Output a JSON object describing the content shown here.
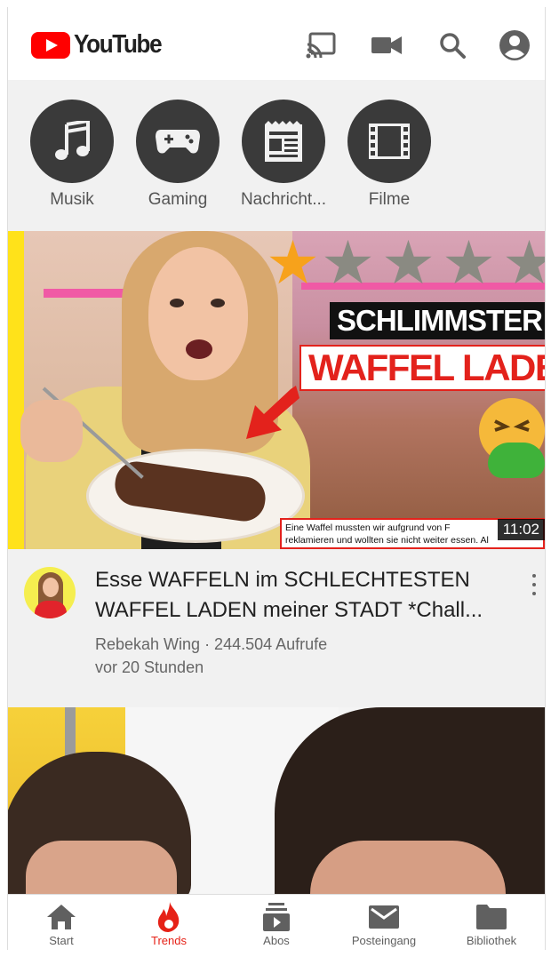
{
  "header": {
    "logo_text": "YouTube",
    "icons": [
      "cast-icon",
      "camera-icon",
      "search-icon",
      "account-icon"
    ]
  },
  "categories": [
    {
      "label": "Musik",
      "icon": "music-icon"
    },
    {
      "label": "Gaming",
      "icon": "gamepad-icon"
    },
    {
      "label": "Nachricht...",
      "icon": "news-icon"
    },
    {
      "label": "Filme",
      "icon": "film-icon"
    }
  ],
  "video1": {
    "thumbnail_text_top": "SCHLIMMSTER",
    "thumbnail_text_main": "WAFFEL LADEN",
    "thumbnail_caption_line1": "Eine Waffel mussten wir aufgrund von F",
    "thumbnail_caption_line2": "reklamieren und wollten sie nicht weiter essen. Al",
    "duration": "11:02",
    "title": "Esse WAFFELN im SCHLECHTESTEN WAFFEL LADEN meiner STADT *Chall...",
    "meta_line1": "Rebekah Wing · 244.504 Aufrufe",
    "meta_line2": "vor 20 Stunden",
    "rating_filled_stars": 1,
    "rating_total_stars": 5
  },
  "bottom_nav": [
    {
      "label": "Start",
      "icon": "home-icon",
      "active": false
    },
    {
      "label": "Trends",
      "icon": "flame-icon",
      "active": true
    },
    {
      "label": "Abos",
      "icon": "subscriptions-icon",
      "active": false
    },
    {
      "label": "Posteingang",
      "icon": "mail-icon",
      "active": false
    },
    {
      "label": "Bibliothek",
      "icon": "folder-icon",
      "active": false
    }
  ],
  "colors": {
    "brand_red": "#ff0000",
    "active_tab": "#e62117",
    "category_circle": "#3a3a3a"
  }
}
